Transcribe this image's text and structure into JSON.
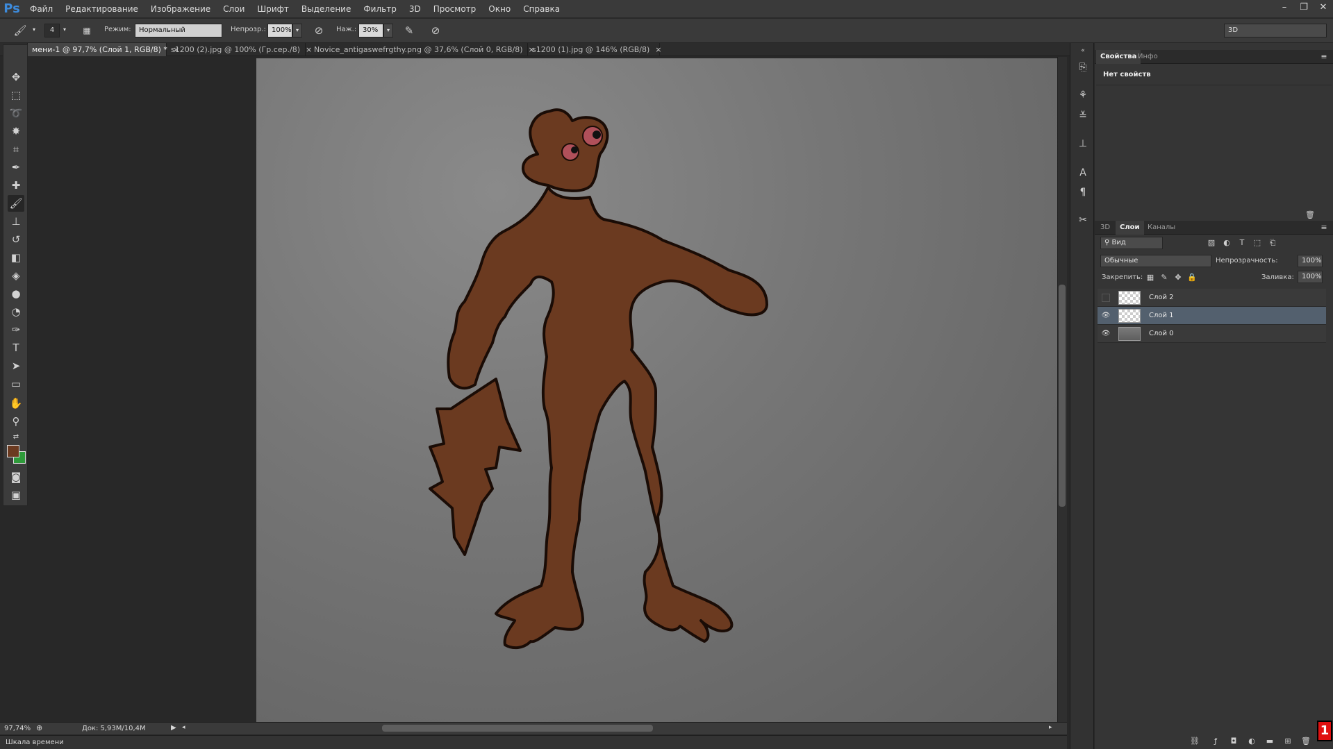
{
  "app": {
    "logo": "Ps"
  },
  "menu": [
    "Файл",
    "Редактирование",
    "Изображение",
    "Слои",
    "Шрифт",
    "Выделение",
    "Фильтр",
    "3D",
    "Просмотр",
    "Окно",
    "Справка"
  ],
  "window_controls": {
    "minimize": "–",
    "restore": "❐",
    "close": "✕"
  },
  "options": {
    "brush_size": "4",
    "mode_label": "Режим:",
    "mode_value": "Нормальный",
    "opacity_label": "Непрозр.:",
    "opacity_value": "100%",
    "pressure_label": "Наж.:",
    "pressure_value": "30%",
    "workspace_value": "3D"
  },
  "tabs": [
    {
      "label": "мени-1 @ 97,7% (Слой 1, RGB/8) *",
      "close": "×"
    },
    {
      "label": "s1200 (2).jpg @ 100% (Гр.сер./8)",
      "close": "×"
    },
    {
      "label": "Novice_antigaswefrgthy.png @ 37,6% (Слой 0, RGB/8)",
      "close": "×"
    },
    {
      "label": "s1200 (1).jpg @ 146% (RGB/8)",
      "close": "×"
    }
  ],
  "colors": {
    "foreground": "#6b3a20",
    "background": "#2e9a3a",
    "figure": "#6b3a20",
    "figure_outline": "#1a0c06",
    "eye": "#b0505a",
    "accent_badge": "#e01010"
  },
  "status": {
    "zoom": "97,74%",
    "doc": "Док: 5,93M/10,4M"
  },
  "timeline": {
    "label": "Шкала времени"
  },
  "properties_panel": {
    "tabs": [
      "Свойства",
      "Инфо"
    ],
    "empty_text": "Нет свойств"
  },
  "layers_panel": {
    "tabs": [
      "3D",
      "Слои",
      "Каналы"
    ],
    "filter_value": "Вид",
    "blend_value": "Обычные",
    "opacity_label": "Непрозрачность:",
    "opacity_value": "100%",
    "lock_label": "Закрепить:",
    "fill_label": "Заливка:",
    "fill_value": "100%",
    "layers": [
      {
        "name": "Слой 2",
        "visible": false,
        "selected": false
      },
      {
        "name": "Слой 1",
        "visible": true,
        "selected": true
      },
      {
        "name": "Слой 0",
        "visible": true,
        "selected": false
      }
    ]
  }
}
